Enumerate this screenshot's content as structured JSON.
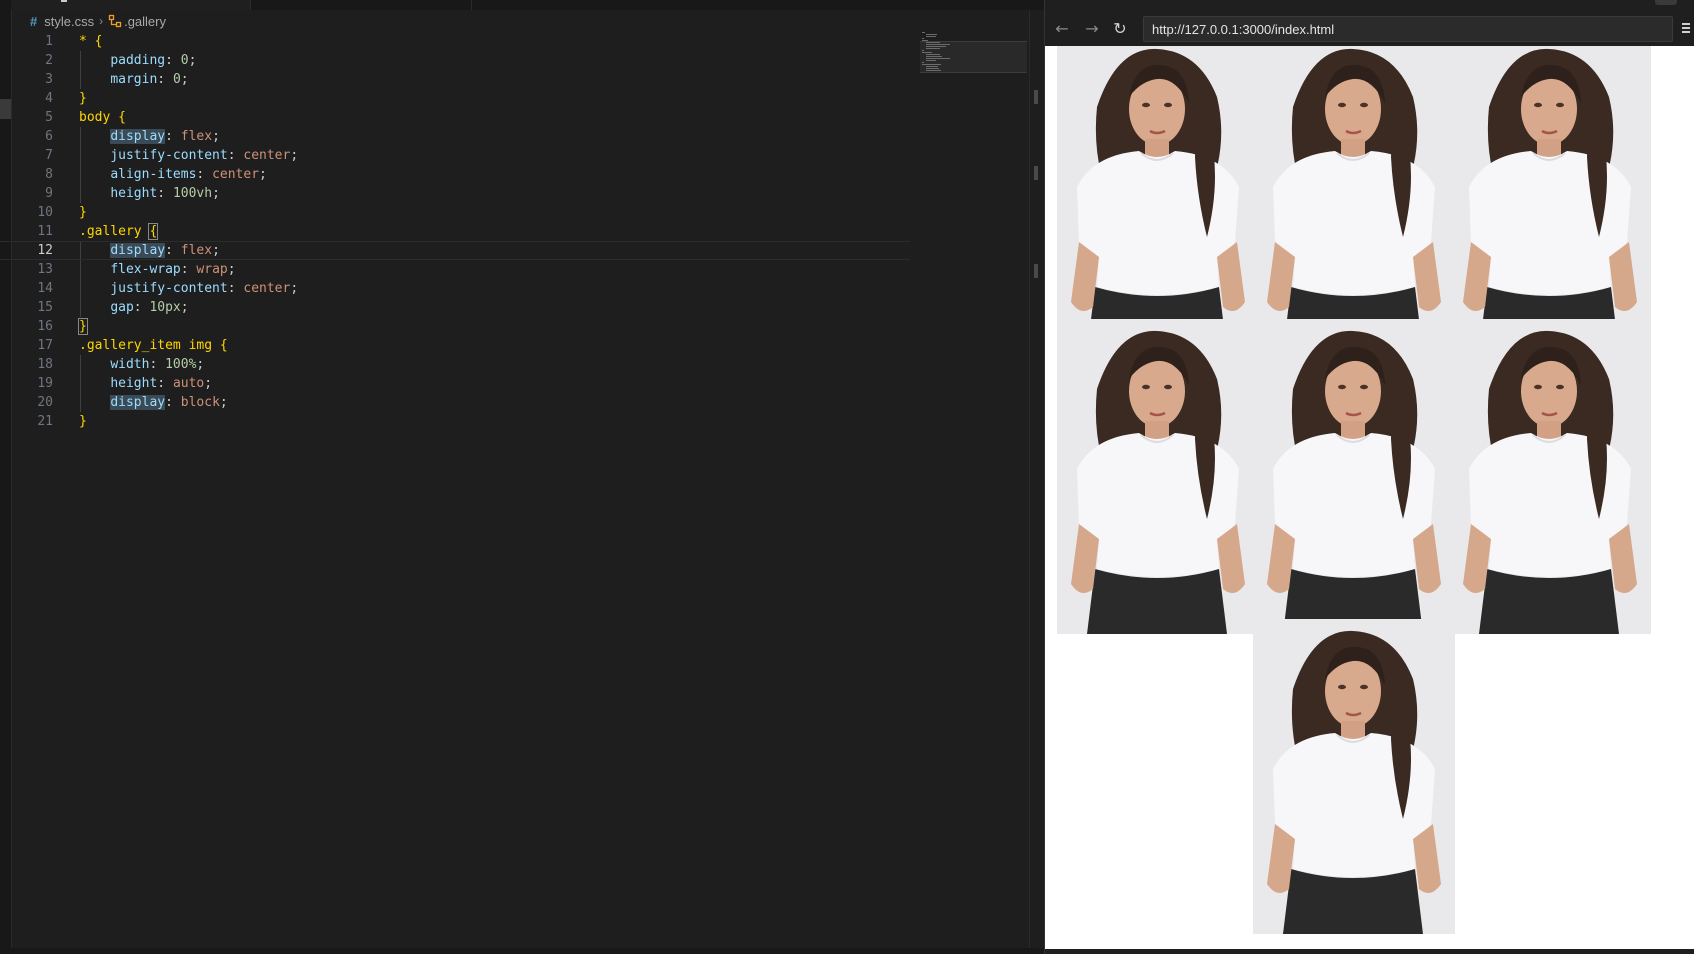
{
  "editor": {
    "breadcrumb": {
      "file": "style.css",
      "symbol": ".gallery"
    },
    "active_line": 12,
    "lines": [
      {
        "n": "1",
        "text": "* {"
      },
      {
        "n": "2",
        "text": "    padding: 0;"
      },
      {
        "n": "3",
        "text": "    margin: 0;"
      },
      {
        "n": "4",
        "text": "}"
      },
      {
        "n": "5",
        "text": "body {"
      },
      {
        "n": "6",
        "text": "    display: flex;"
      },
      {
        "n": "7",
        "text": "    justify-content: center;"
      },
      {
        "n": "8",
        "text": "    align-items: center;"
      },
      {
        "n": "9",
        "text": "    height: 100vh;"
      },
      {
        "n": "10",
        "text": "}"
      },
      {
        "n": "11",
        "text": ".gallery {"
      },
      {
        "n": "12",
        "text": "    display: flex;"
      },
      {
        "n": "13",
        "text": "    flex-wrap: wrap;"
      },
      {
        "n": "14",
        "text": "    justify-content: center;"
      },
      {
        "n": "15",
        "text": "    gap: 10px;"
      },
      {
        "n": "16",
        "text": "}"
      },
      {
        "n": "17",
        "text": ".gallery_item img {"
      },
      {
        "n": "18",
        "text": "    width: 100%;"
      },
      {
        "n": "19",
        "text": "    height: auto;"
      },
      {
        "n": "20",
        "text": "    display: block;"
      },
      {
        "n": "21",
        "text": "}"
      }
    ]
  },
  "browser": {
    "url": "http://127.0.0.1:3000/index.html",
    "back_icon": "arrow-left-icon",
    "forward_icon": "arrow-right-icon",
    "reload_icon": "reload-icon",
    "gallery": [
      {
        "name": "gallery-item-1"
      },
      {
        "name": "gallery-item-2"
      },
      {
        "name": "gallery-item-3"
      },
      {
        "name": "gallery-item-4"
      },
      {
        "name": "gallery-item-5"
      },
      {
        "name": "gallery-item-6"
      },
      {
        "name": "gallery-item-7"
      }
    ]
  },
  "colors": {
    "editor_bg": "#1e1e1e",
    "selector": "#ffd700",
    "property": "#9cdcfe",
    "value": "#ce9178",
    "number": "#b5cea8",
    "browser_bg": "#ffffff"
  }
}
